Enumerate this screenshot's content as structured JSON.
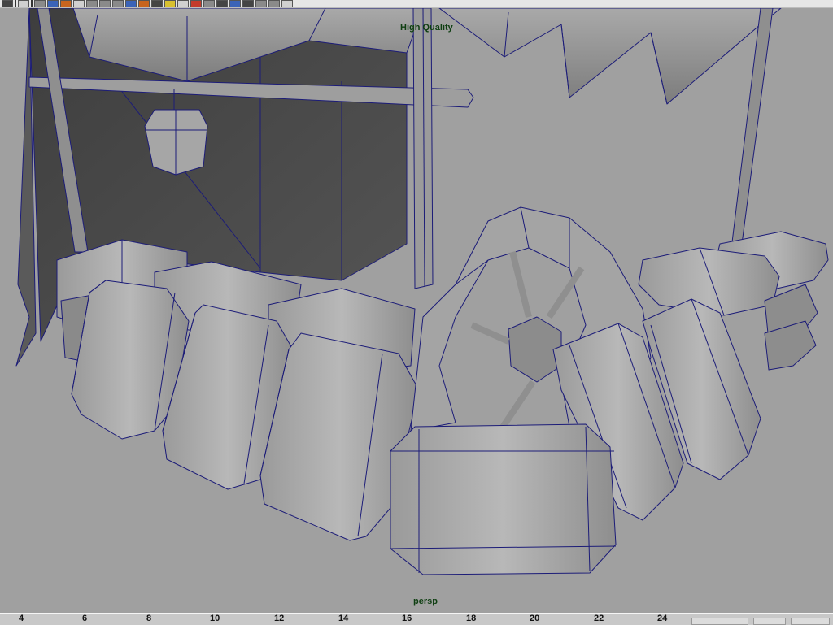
{
  "shelf": {
    "icons": [
      "sphere-icon",
      "cube-icon",
      "grid-icon",
      "paint-icon",
      "render-icon",
      "light-icon",
      "texture-icon",
      "camera-icon",
      "globe-icon",
      "sphere-blue-icon",
      "brick-icon",
      "shader-icon",
      "bulb-icon",
      "ball-icon",
      "fire-icon",
      "swatch-icon",
      "cube-gray-icon",
      "filter-icon",
      "connect-icon",
      "diamond-icon",
      "node-icon",
      "wave-icon"
    ]
  },
  "viewport": {
    "quality_label": "High Quality",
    "camera_label": "persp",
    "wire_color": "#1c1c78",
    "background_color": "#a0a0a0"
  },
  "timeline": {
    "ticks": [
      "4",
      "6",
      "8",
      "10",
      "12",
      "14",
      "16",
      "18",
      "20",
      "22",
      "24"
    ]
  }
}
